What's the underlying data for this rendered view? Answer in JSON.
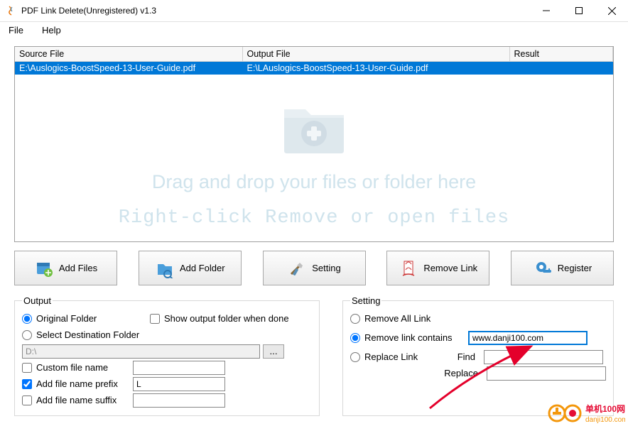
{
  "window": {
    "title": "PDF Link Delete(Unregistered) v1.3"
  },
  "menu": {
    "file": "File",
    "help": "Help"
  },
  "grid": {
    "headers": {
      "source": "Source File",
      "output": "Output File",
      "result": "Result"
    },
    "rows": [
      {
        "source": "E:\\Auslogics-BoostSpeed-13-User-Guide.pdf",
        "output": "E:\\LAuslogics-BoostSpeed-13-User-Guide.pdf",
        "result": ""
      }
    ]
  },
  "dropzone": {
    "line1": "Drag and drop your files or folder here",
    "line2": "Right-click Remove or open files"
  },
  "buttons": {
    "add_files": "Add Files",
    "add_folder": "Add Folder",
    "setting": "Setting",
    "remove_link": "Remove Link",
    "register": "Register"
  },
  "output": {
    "legend": "Output",
    "original_folder": "Original Folder",
    "select_dest": "Select Destination Folder",
    "show_when_done": "Show output folder when done",
    "dest_path": "D:\\",
    "custom_name": "Custom file name",
    "prefix_label": "Add file name prefix",
    "prefix_value": "L",
    "suffix_label": "Add file name suffix",
    "browse_ellipsis": "..."
  },
  "setting": {
    "legend": "Setting",
    "remove_all": "Remove All Link",
    "remove_contains": "Remove link contains",
    "contains_value": "www.danji100.com",
    "replace_link": "Replace Link",
    "find": "Find",
    "replace": "Replace"
  },
  "watermark": {
    "text_cn": "单机100网",
    "text_url": "danji100.com"
  }
}
